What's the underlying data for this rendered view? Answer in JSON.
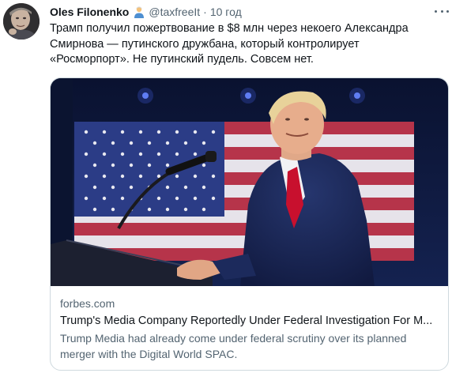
{
  "author": {
    "name": "Oles Filonenko",
    "handle": "@taxfreeIt",
    "separator": "·",
    "time": "10 год",
    "badge_icon": "person-emoji-icon"
  },
  "tweet": {
    "text_lines": [
      "Трамп получил пожертвование в $8 млн через некоего Александра",
      "Смирнова — путинского дружбана, который контролирует",
      "«Росморпорт». Не путинский пудель. Совсем нет."
    ]
  },
  "card": {
    "domain": "forbes.com",
    "title": "Trump's Media Company Reportedly Under Federal Investigation For M...",
    "description_lines": [
      "Trump Media had already come under federal scrutiny over its planned",
      "merger with the Digital World SPAC."
    ]
  },
  "colors": {
    "text_primary": "#0f1419",
    "text_secondary": "#536471",
    "card_border": "#cfd9de",
    "image_background": "#0e1a3a",
    "flag_red": "#b6344a",
    "tie_red": "#c8102e"
  }
}
